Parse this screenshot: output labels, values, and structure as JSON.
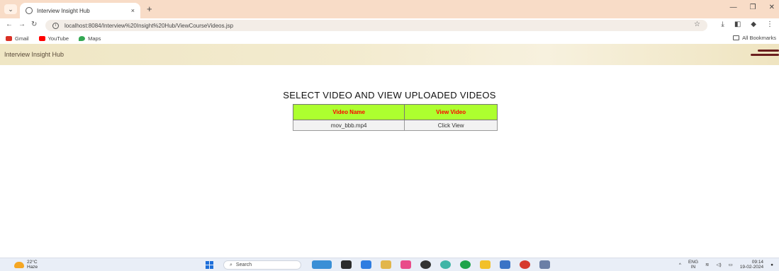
{
  "browser": {
    "tab_menu_icon": "chevron-down-icon",
    "tab_title": "Interview Insight Hub",
    "tab_close": "×",
    "new_tab": "+",
    "window_controls": {
      "minimize": "—",
      "restore": "❐",
      "close": "✕"
    },
    "url": "localhost:8084/Interview%20Insight%20Hub/ViewCourseVideos.jsp",
    "bookmarks": [
      {
        "label": "Gmail",
        "color": "#d93025"
      },
      {
        "label": "YouTube",
        "color": "#ff0000"
      },
      {
        "label": "Maps",
        "color": "#34a853"
      }
    ],
    "all_bookmarks": "All Bookmarks"
  },
  "site": {
    "title": "Interview Insight Hub",
    "menu_icon": "hamburger-menu-icon",
    "accent_color": "#6b1e1e"
  },
  "main": {
    "heading": "SELECT VIDEO AND VIEW UPLOADED VIDEOS",
    "table": {
      "header_bg": "#adff2f",
      "header_color": "#ff0000",
      "columns": [
        "Video Name",
        "View Video"
      ],
      "rows": [
        {
          "video_name": "mov_bbb.mp4",
          "action": "Click View"
        }
      ]
    }
  },
  "taskbar": {
    "weather_temp": "22°C",
    "weather_desc": "Haze",
    "search_placeholder": "Search",
    "tray_lang": "ENG",
    "tray_region": "IN",
    "time": "09:14",
    "date": "19-02-2024"
  }
}
